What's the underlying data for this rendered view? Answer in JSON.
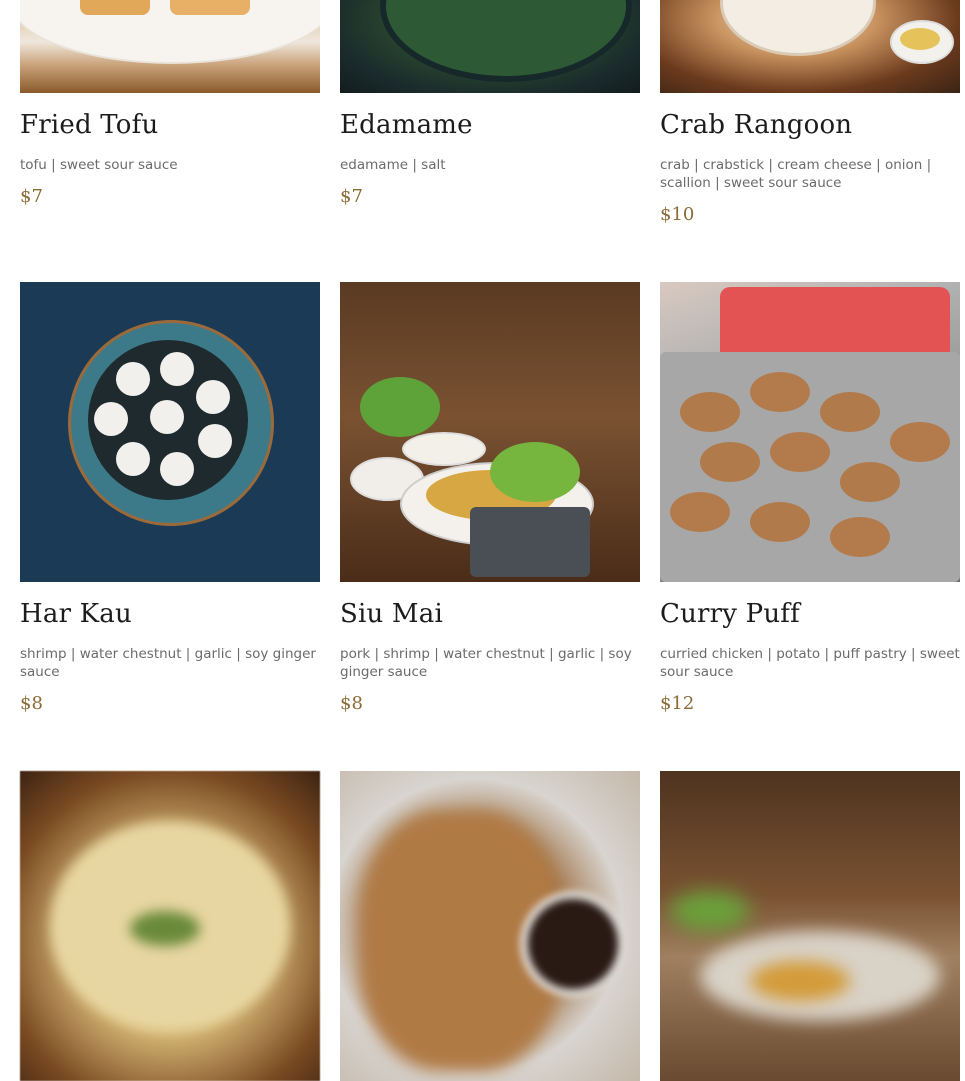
{
  "menu_items": [
    {
      "name": "Fried Tofu",
      "description": "tofu | sweet sour sauce",
      "price": "$7"
    },
    {
      "name": "Edamame",
      "description": "edamame | salt",
      "price": "$7"
    },
    {
      "name": "Crab Rangoon",
      "description": "crab | crabstick | cream cheese | onion | scallion | sweet sour sauce",
      "price": "$10"
    },
    {
      "name": "Har Kau",
      "description": "shrimp | water chestnut | garlic | soy ginger sauce",
      "price": "$8"
    },
    {
      "name": "Siu Mai",
      "description": "pork | shrimp | water chestnut | garlic | soy ginger sauce",
      "price": "$8"
    },
    {
      "name": "Curry Puff",
      "description": "curried chicken | potato | puff pastry | sweet sour sauce",
      "price": "$12"
    }
  ],
  "colors": {
    "price": "#8a6a35",
    "title": "#1c1c1c",
    "description": "#6b6b6b"
  }
}
